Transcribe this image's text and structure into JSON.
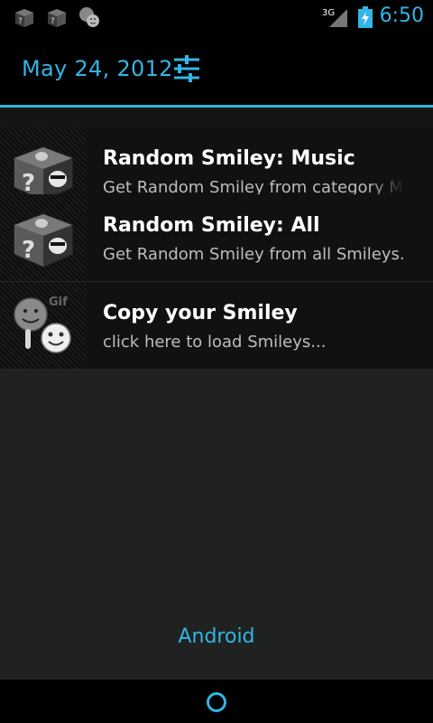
{
  "status_bar": {
    "time": "6:50",
    "network_type": "3G",
    "notification_icons": [
      "dice-icon",
      "dice-icon",
      "smiley-icon"
    ],
    "accent_color": "#33b5e5"
  },
  "header": {
    "date": "May 24, 2012",
    "settings_icon": "quick-settings-icon"
  },
  "notifications": [
    {
      "title": "Random Smiley: Music",
      "text": "Get Random Smiley from category Mu",
      "icon": "dice-icon"
    },
    {
      "title": "Random Smiley: All",
      "text": "Get Random Smiley from all Smileys...",
      "icon": "dice-icon"
    },
    {
      "title": "Copy your Smiley",
      "text": "click here to load Smileys...",
      "icon": "smiley-gif-icon"
    }
  ],
  "carrier_label": "Android",
  "navigation": {
    "home_icon": "home-icon"
  }
}
